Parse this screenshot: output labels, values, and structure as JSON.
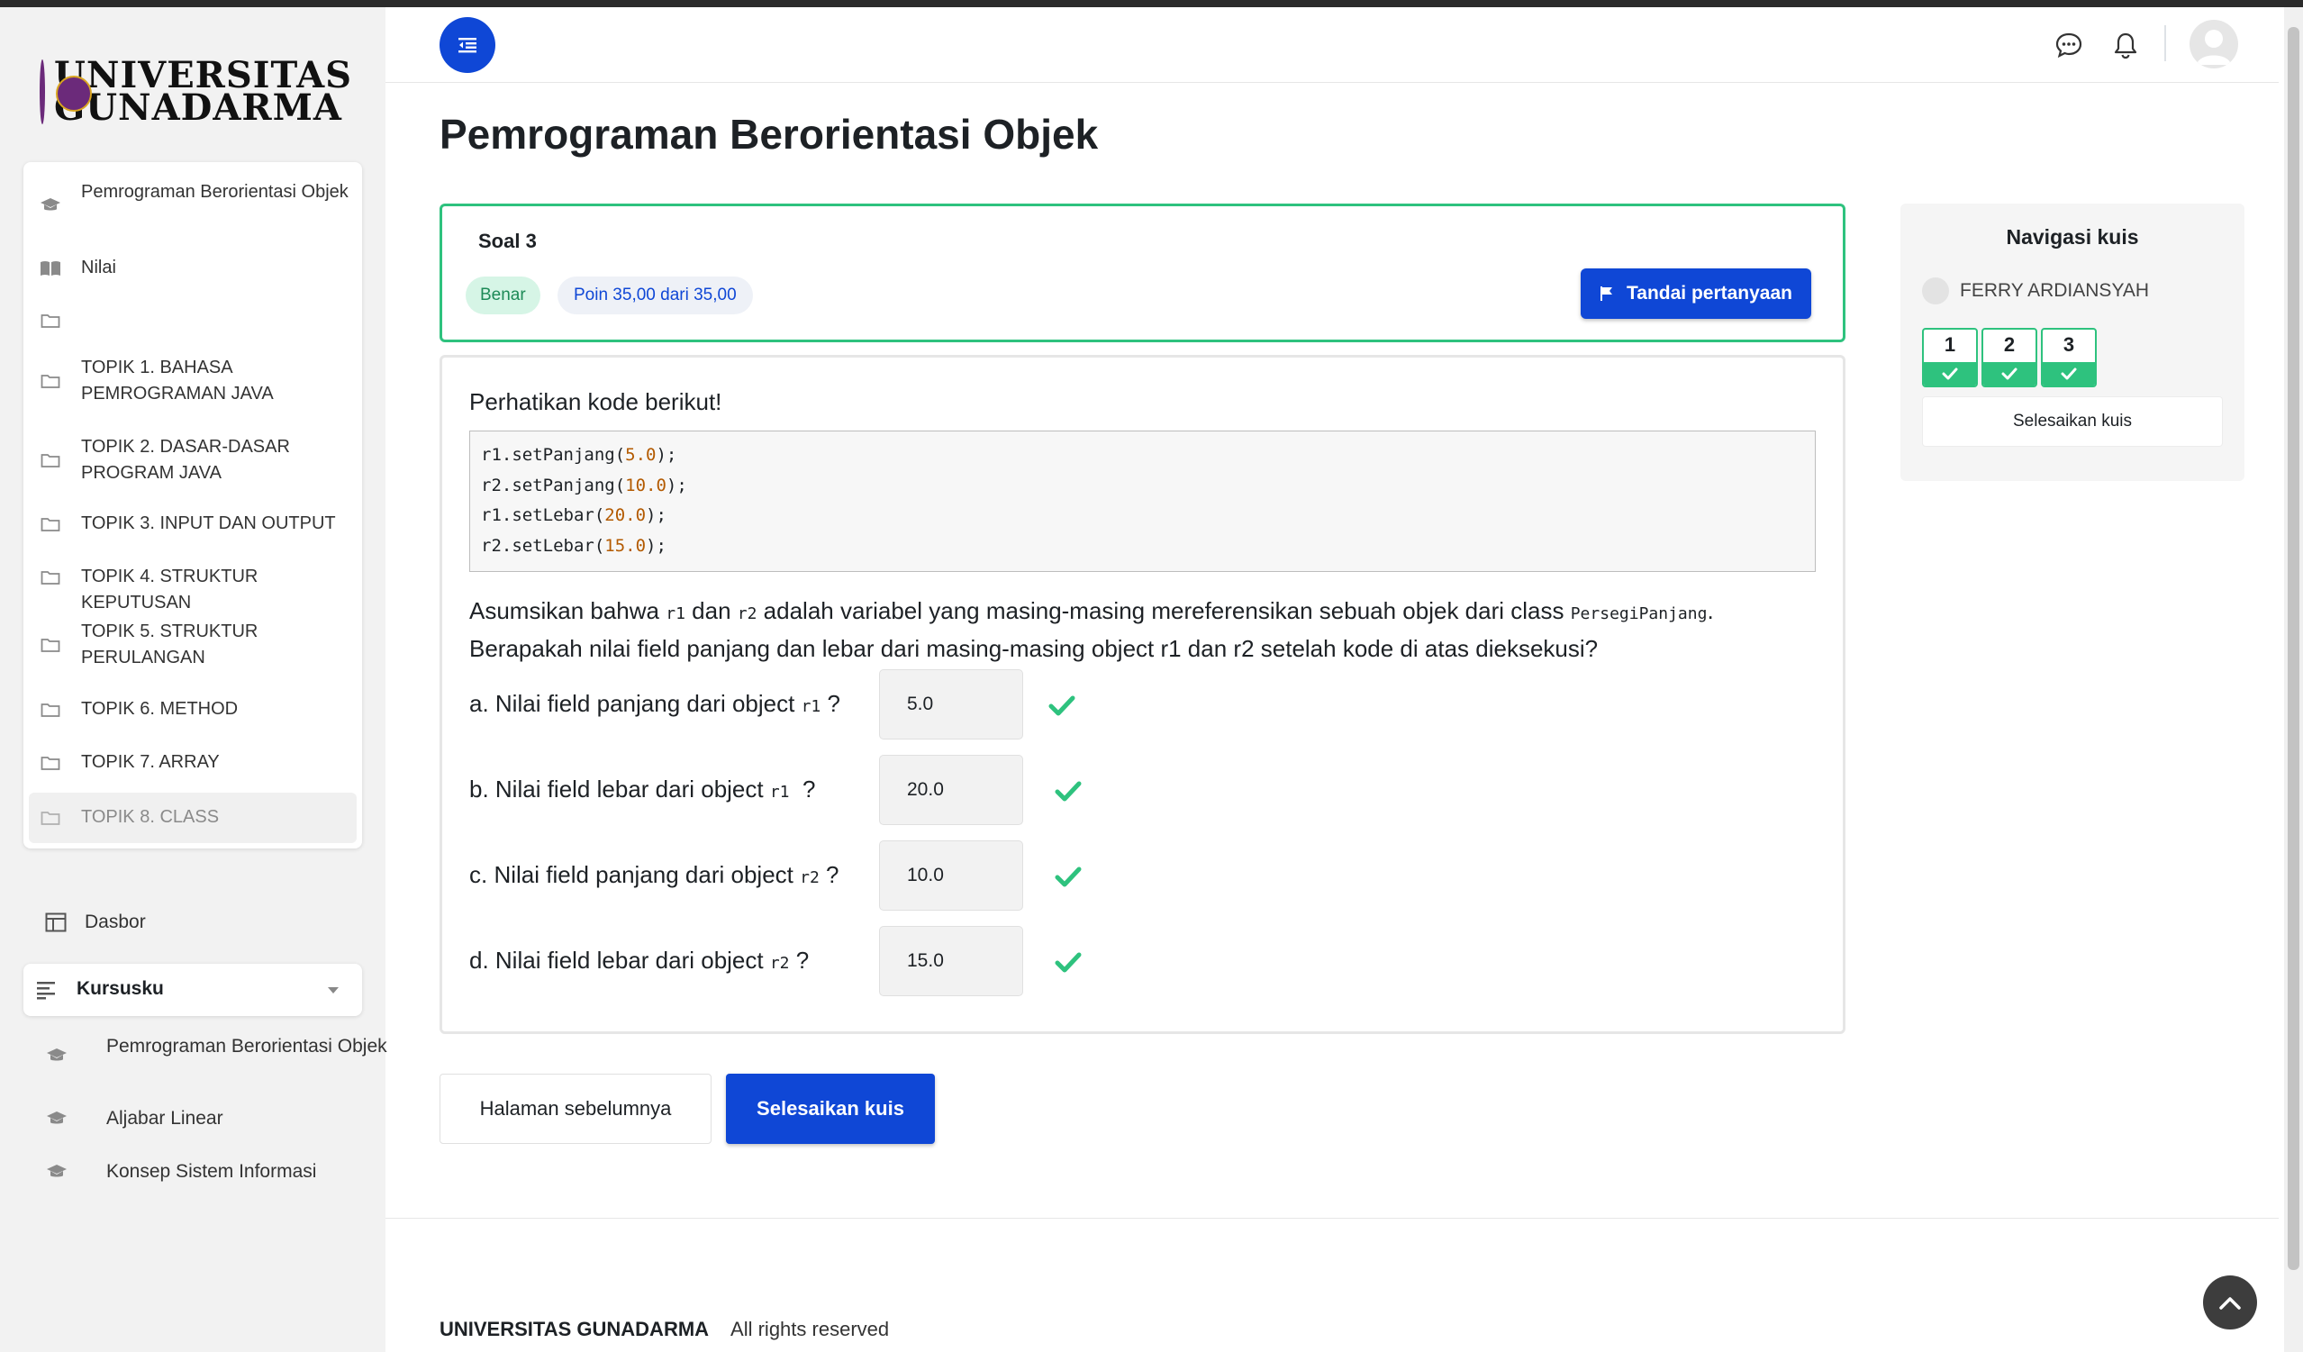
{
  "logo": {
    "text_line1": "UNIVERSITAS",
    "text_line2": "GUNADARMA"
  },
  "sidebar": {
    "course_items": [
      {
        "label": "Pemrograman Berorientasi Objek",
        "icon": "graduation-cap-icon"
      },
      {
        "label": "Nilai",
        "icon": "book-icon"
      },
      {
        "label": "",
        "icon": "folder-icon"
      },
      {
        "label": "TOPIK 1. BAHASA PEMROGRAMAN JAVA",
        "icon": "folder-icon"
      },
      {
        "label": "TOPIK 2. DASAR-DASAR PROGRAM JAVA",
        "icon": "folder-icon"
      },
      {
        "label": "TOPIK 3. INPUT DAN OUTPUT",
        "icon": "folder-icon"
      },
      {
        "label": "TOPIK 4. STRUKTUR KEPUTUSAN",
        "icon": "folder-icon"
      },
      {
        "label": "TOPIK 5. STRUKTUR PERULANGAN",
        "icon": "folder-icon"
      },
      {
        "label": "TOPIK 6. METHOD",
        "icon": "folder-icon"
      },
      {
        "label": "TOPIK 7. ARRAY",
        "icon": "folder-icon"
      },
      {
        "label": "TOPIK 8. CLASS",
        "icon": "folder-icon"
      }
    ],
    "dasbor_label": "Dasbor",
    "kursusku_label": "Kursusku",
    "my_courses": [
      {
        "label": "Pemrograman Berorientasi Objek"
      },
      {
        "label": "Aljabar Linear"
      },
      {
        "label": "Konsep Sistem Informasi"
      }
    ]
  },
  "page": {
    "title": "Pemrograman Berorientasi Objek"
  },
  "question": {
    "number_label": "Soal 3",
    "status": "Benar",
    "points": "Poin 35,00 dari 35,00",
    "flag_label": "Tandai pertanyaan",
    "intro": "Perhatikan kode berikut!",
    "code": {
      "l0": {
        "pre": "r1.setPanjang(",
        "num": "5.0",
        "post": ");"
      },
      "l1": {
        "pre": "r2.setPanjang(",
        "num": "10.0",
        "post": ");"
      },
      "l2": {
        "pre": "r1.setLebar(",
        "num": "20.0",
        "post": ");"
      },
      "l3": {
        "pre": "r2.setLebar(",
        "num": "15.0",
        "post": ");"
      }
    },
    "text": {
      "p1": "Asumsikan bahwa ",
      "v1": "r1",
      "p2": " dan ",
      "v2": "r2",
      "p3": " adalah variabel yang masing-masing mereferensikan sebuah objek dari class ",
      "cls": "PersegiPanjang",
      "p4": ".",
      "line2": "Berapakah nilai field panjang dan lebar dari masing-masing object r1 dan r2 setelah kode di atas dieksekusi?"
    },
    "answers": [
      {
        "pre": "a. Nilai field panjang dari object ",
        "var": "r1",
        "post": " ?",
        "value": "5.0"
      },
      {
        "pre": "b. Nilai field lebar dari object ",
        "var": "r1",
        "post": "  ?",
        "value": "20.0"
      },
      {
        "pre": "c. Nilai field panjang dari object ",
        "var": "r2",
        "post": " ?",
        "value": "10.0"
      },
      {
        "pre": "d. Nilai field lebar dari object ",
        "var": "r2",
        "post": " ?",
        "value": "15.0"
      }
    ]
  },
  "buttons": {
    "prev": "Halaman sebelumnya",
    "finish": "Selesaikan kuis"
  },
  "quiz_nav": {
    "title": "Navigasi kuis",
    "user": "FERRY ARDIANSYAH",
    "questions": [
      "1",
      "2",
      "3"
    ],
    "finish": "Selesaikan kuis"
  },
  "footer": {
    "brand": "UNIVERSITAS GUNADARMA",
    "rights": "All rights reserved"
  },
  "colors": {
    "primary": "#0f47d6",
    "correct": "#2ec27e",
    "sidebar_bg": "#f2f2f2"
  }
}
